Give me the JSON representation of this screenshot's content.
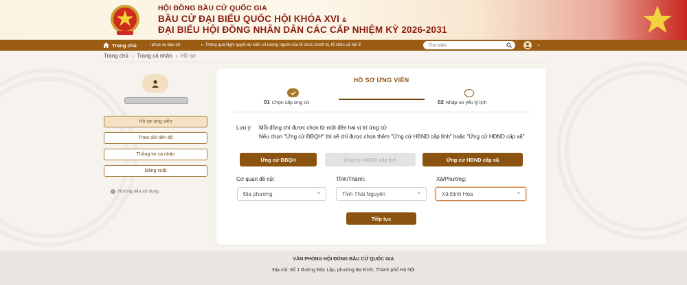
{
  "header": {
    "org": "HỘI ĐỒNG BẦU CỬ QUỐC GIA",
    "title_line1": "BẦU CỬ ĐẠI BIỂU QUỐC HỘI KHÓA XVI",
    "amp": "&",
    "title_line2": "ĐẠI BIỂU HỘI ĐỒNG NHÂN DÂN CÁC CẤP NHIỆM KỲ 2026-2031"
  },
  "nav": {
    "home": "Trang chủ",
    "service": "i phục vụ bầu cử",
    "news": "Thông qua Nghị quyết dự kiến số lượng người của tổ chức chính trị, tổ chức xã hội đ",
    "search_placeholder": "Tìm kiếm"
  },
  "breadcrumb": {
    "items": [
      "Trang chủ",
      "Trang cá nhân",
      "Hồ sơ"
    ],
    "sep": "›"
  },
  "sidebar": {
    "items": [
      {
        "label": "Hồ sơ ứng viên",
        "active": true
      },
      {
        "label": "Theo dõi tiến độ",
        "active": false
      },
      {
        "label": "Thông tin cá nhân",
        "active": false
      },
      {
        "label": "Đăng xuất",
        "active": false
      }
    ],
    "help": "Hướng dẫn sử dụng"
  },
  "card": {
    "title": "HỒ SƠ ỨNG VIÊN",
    "steps": [
      {
        "num": "01",
        "label": "Chọn cấp ứng cử",
        "done": true
      },
      {
        "num": "02",
        "label": "Nhập sơ yếu lý lịch",
        "done": false
      }
    ],
    "note_label": "Lưu ý:",
    "note_line1": "Mỗi đồng chí được chọn từ một đến hai vị trí ứng cử",
    "note_line2": "Nếu chọn \"Ứng cử ĐBQH\" thì sẽ chỉ được chọn thêm \"Ứng cử HĐND cấp tỉnh\" hoặc \"Ứng cử HĐND cấp xã\"",
    "roles": [
      {
        "label": "Ứng cử ĐBQH",
        "selected": true
      },
      {
        "label": "Ứng cử HĐND cấp tỉnh",
        "selected": false
      },
      {
        "label": "Ứng cử HĐND cấp xã",
        "selected": true
      }
    ],
    "fields": [
      {
        "label": "Cơ quan đề cử:",
        "value": "Địa phương"
      },
      {
        "label": "Tỉnh/Thành:",
        "value": "Tỉnh Thái Nguyên"
      },
      {
        "label": "Xã/Phường:",
        "value": "Xã Định Hóa"
      }
    ],
    "clear_glyph": "×",
    "continue": "Tiếp tục"
  },
  "footer": {
    "org": "VĂN PHÒNG HỘI ĐỒNG BẦU CỬ QUỐC GIA",
    "address": "Địa chỉ: Số 1 đường Độc Lập, phường Ba Đình, Thành phố Hà Nội"
  },
  "colors": {
    "brand": "#8a5410",
    "navbar": "#9a5b12",
    "header_red": "#8b1a10",
    "flag_red": "#c8261e",
    "star": "#f3d33c"
  },
  "icons": [
    "emblem-icon",
    "star-icon",
    "home-icon",
    "search-icon",
    "user-icon",
    "check-icon",
    "help-icon",
    "clear-icon"
  ]
}
